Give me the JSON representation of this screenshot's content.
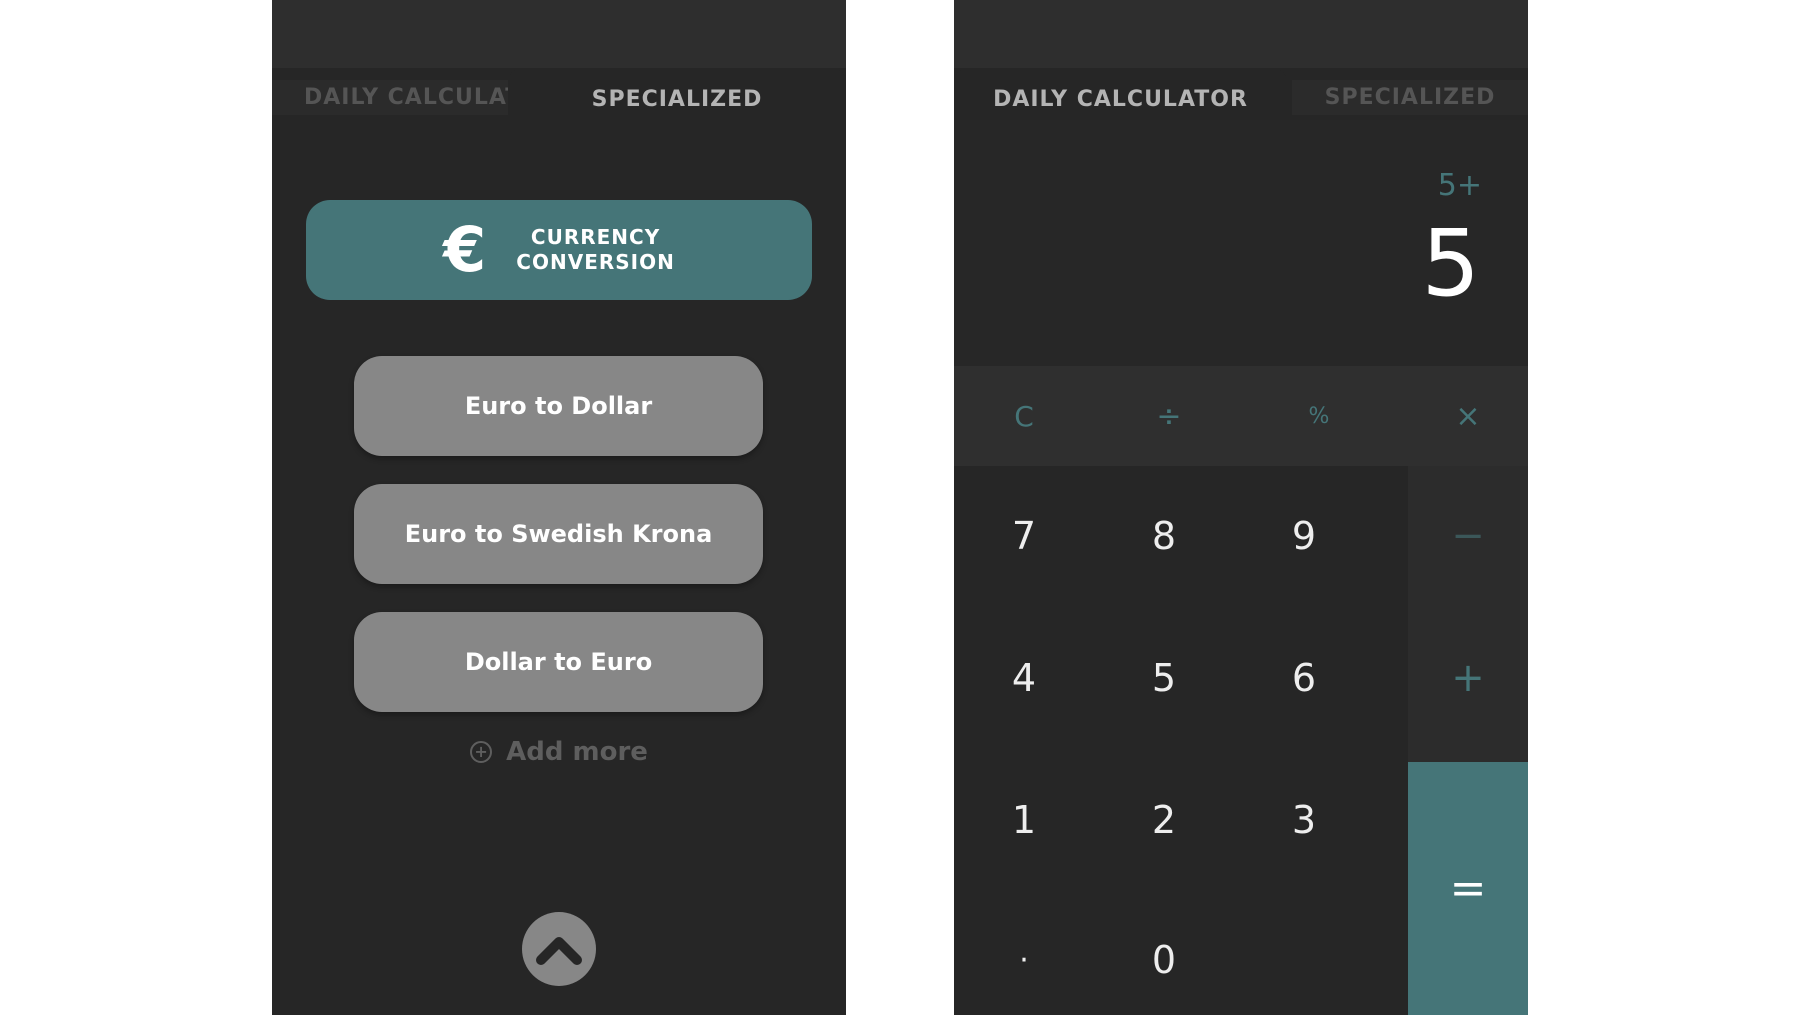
{
  "left_screen": {
    "tabs": {
      "daily": "DAILY CALCULAT",
      "specialized": "SPECIALIZED"
    },
    "currency": {
      "icon": "euro-icon",
      "glyph": "€",
      "line1": "CURRENCY",
      "line2": "CONVERSION"
    },
    "conversions": [
      "Euro to Dollar",
      "Euro to Swedish Krona",
      "Dollar to Euro"
    ],
    "add_more": {
      "icon": "plus-circle-icon",
      "glyph": "+",
      "label": "Add more"
    },
    "up_button_icon": "chevron-up-icon"
  },
  "right_screen": {
    "tabs": {
      "daily": "DAILY CALCULATOR",
      "specialized": "SPECIALIZED"
    },
    "display": {
      "expression": "5+",
      "result": "5"
    },
    "operators": {
      "clear": "C",
      "divide": "÷",
      "percent": "%",
      "multiply": "×"
    },
    "keys": {
      "k7": "7",
      "k8": "8",
      "k9": "9",
      "k4": "4",
      "k5": "5",
      "k6": "6",
      "k1": "1",
      "k2": "2",
      "k3": "3",
      "dot": "·",
      "k0": "0"
    },
    "side": {
      "minus": "−",
      "plus": "+",
      "equals": "="
    }
  },
  "colors": {
    "background": "#262626",
    "accent": "#457578",
    "button": "#878787"
  }
}
